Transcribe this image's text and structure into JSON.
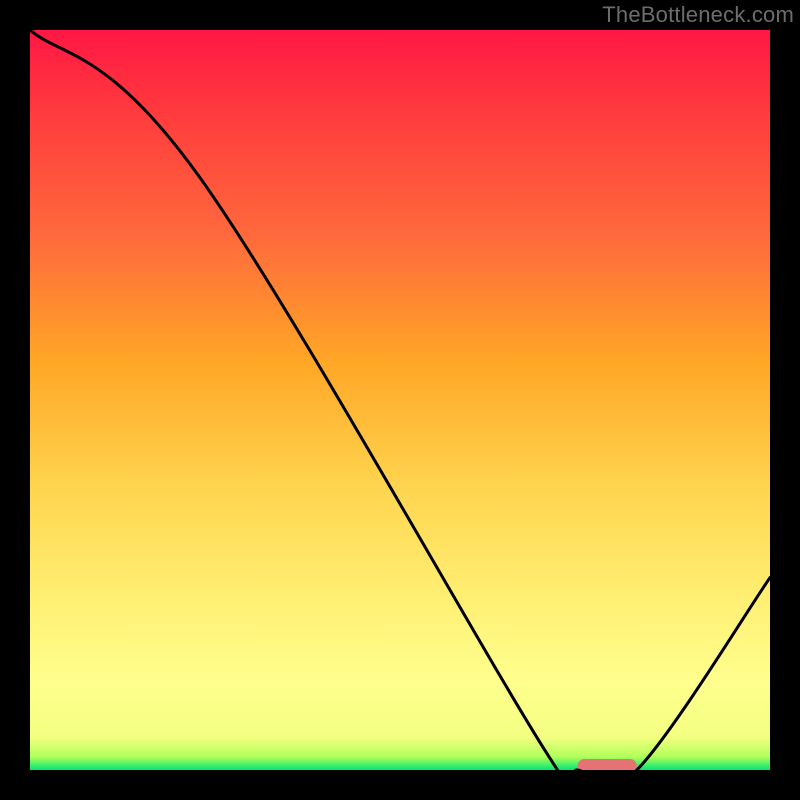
{
  "watermark": "TheBottleneck.com",
  "chart_data": {
    "type": "line",
    "title": "",
    "xlabel": "",
    "ylabel": "",
    "xlim": [
      0,
      100
    ],
    "ylim": [
      0,
      100
    ],
    "series": [
      {
        "name": "curve",
        "x": [
          0,
          23,
          70,
          74,
          82,
          100
        ],
        "values": [
          100,
          80,
          2,
          0,
          0,
          26
        ]
      }
    ],
    "marker": {
      "x_start": 74,
      "x_end": 82,
      "y": 0,
      "color": "#e57373"
    },
    "gradient_stops": [
      {
        "offset": 0.0,
        "color": "#ff1744"
      },
      {
        "offset": 0.12,
        "color": "#ff3d3d"
      },
      {
        "offset": 0.28,
        "color": "#ff6a3c"
      },
      {
        "offset": 0.45,
        "color": "#ffa726"
      },
      {
        "offset": 0.62,
        "color": "#ffd54f"
      },
      {
        "offset": 0.78,
        "color": "#fff176"
      },
      {
        "offset": 0.88,
        "color": "#ffff8d"
      },
      {
        "offset": 0.955,
        "color": "#f4ff81"
      },
      {
        "offset": 0.982,
        "color": "#b2ff59"
      },
      {
        "offset": 1.0,
        "color": "#00e676"
      }
    ]
  }
}
